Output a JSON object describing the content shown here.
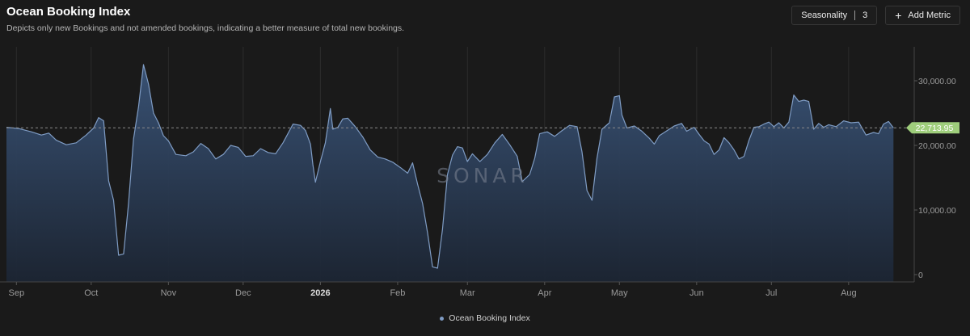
{
  "header": {
    "title": "Ocean Booking Index",
    "subtitle": "Depicts only new Bookings and not amended bookings, indicating a better measure of total new bookings."
  },
  "controls": {
    "seasonality_label": "Seasonality",
    "seasonality_value": "3",
    "add_metric_label": "Add Metric"
  },
  "watermark": "SONAR",
  "colors": {
    "background": "#1a1a1a",
    "line": "#7f9cc4",
    "fill_top": "#3a5478",
    "fill_bottom": "#1c2533",
    "last_value_badge": "#9fce7c",
    "grid": "#2c2c2c"
  },
  "chart_data": {
    "type": "area",
    "title": "Ocean Booking Index",
    "xlabel": "",
    "ylabel": "",
    "ylim": [
      0,
      35000
    ],
    "y_ticks": [
      {
        "value": 0,
        "label": "0"
      },
      {
        "value": 10000,
        "label": "10,000.00"
      },
      {
        "value": 20000,
        "label": "20,000.00"
      },
      {
        "value": 30000,
        "label": "30,000.00"
      }
    ],
    "x_ticks": [
      {
        "day": 4,
        "label": "Sep",
        "bold": false
      },
      {
        "day": 34,
        "label": "Oct",
        "bold": false
      },
      {
        "day": 65,
        "label": "Nov",
        "bold": false
      },
      {
        "day": 95,
        "label": "Dec",
        "bold": false
      },
      {
        "day": 126,
        "label": "2026",
        "bold": true
      },
      {
        "day": 157,
        "label": "Feb",
        "bold": false
      },
      {
        "day": 185,
        "label": "Mar",
        "bold": false
      },
      {
        "day": 216,
        "label": "Apr",
        "bold": false
      },
      {
        "day": 246,
        "label": "May",
        "bold": false
      },
      {
        "day": 277,
        "label": "Jun",
        "bold": false
      },
      {
        "day": 307,
        "label": "Jul",
        "bold": false
      },
      {
        "day": 338,
        "label": "Aug",
        "bold": false
      }
    ],
    "x_range": [
      0,
      364
    ],
    "grid": true,
    "legend_position": "bottom-center",
    "last_value": 22713.95,
    "last_value_label": "22,713.95",
    "series": [
      {
        "name": "Ocean Booking Index",
        "points": [
          [
            0,
            22800
          ],
          [
            5,
            22600
          ],
          [
            10,
            22100
          ],
          [
            14,
            21600
          ],
          [
            17,
            21900
          ],
          [
            20,
            20800
          ],
          [
            24,
            20100
          ],
          [
            28,
            20400
          ],
          [
            32,
            21600
          ],
          [
            35,
            22700
          ],
          [
            37,
            24300
          ],
          [
            39,
            23800
          ],
          [
            41,
            14500
          ],
          [
            43,
            11500
          ],
          [
            45,
            3000
          ],
          [
            47,
            3200
          ],
          [
            49,
            11000
          ],
          [
            51,
            21000
          ],
          [
            53,
            26000
          ],
          [
            55,
            32500
          ],
          [
            57,
            29500
          ],
          [
            59,
            25000
          ],
          [
            61,
            23500
          ],
          [
            63,
            21500
          ],
          [
            65,
            20700
          ],
          [
            68,
            18600
          ],
          [
            72,
            18400
          ],
          [
            75,
            19000
          ],
          [
            78,
            20300
          ],
          [
            81,
            19500
          ],
          [
            84,
            17900
          ],
          [
            87,
            18600
          ],
          [
            90,
            20000
          ],
          [
            93,
            19700
          ],
          [
            96,
            18300
          ],
          [
            99,
            18400
          ],
          [
            102,
            19500
          ],
          [
            105,
            18900
          ],
          [
            108,
            18700
          ],
          [
            111,
            20400
          ],
          [
            115,
            23300
          ],
          [
            118,
            23100
          ],
          [
            120,
            22300
          ],
          [
            122,
            20200
          ],
          [
            123,
            17000
          ],
          [
            124,
            14300
          ],
          [
            126,
            17500
          ],
          [
            128,
            20400
          ],
          [
            130,
            25700
          ],
          [
            131,
            22500
          ],
          [
            133,
            22800
          ],
          [
            135,
            24100
          ],
          [
            137,
            24200
          ],
          [
            140,
            22900
          ],
          [
            143,
            21300
          ],
          [
            146,
            19300
          ],
          [
            149,
            18200
          ],
          [
            152,
            17900
          ],
          [
            155,
            17400
          ],
          [
            158,
            16600
          ],
          [
            161,
            15700
          ],
          [
            163,
            17300
          ],
          [
            165,
            14000
          ],
          [
            167,
            11000
          ],
          [
            169,
            6500
          ],
          [
            171,
            1200
          ],
          [
            173,
            1000
          ],
          [
            175,
            7000
          ],
          [
            177,
            15500
          ],
          [
            179,
            18500
          ],
          [
            181,
            19800
          ],
          [
            183,
            19600
          ],
          [
            185,
            17500
          ],
          [
            187,
            18700
          ],
          [
            190,
            17500
          ],
          [
            193,
            18600
          ],
          [
            196,
            20400
          ],
          [
            199,
            21700
          ],
          [
            202,
            20100
          ],
          [
            205,
            18300
          ],
          [
            207,
            14400
          ],
          [
            210,
            15500
          ],
          [
            212,
            18000
          ],
          [
            214,
            21800
          ],
          [
            217,
            22100
          ],
          [
            220,
            21400
          ],
          [
            223,
            22300
          ],
          [
            226,
            23100
          ],
          [
            229,
            22900
          ],
          [
            231,
            19000
          ],
          [
            233,
            13000
          ],
          [
            235,
            11500
          ],
          [
            237,
            18000
          ],
          [
            239,
            22500
          ],
          [
            242,
            23500
          ],
          [
            244,
            27500
          ],
          [
            246,
            27700
          ],
          [
            247,
            24700
          ],
          [
            249,
            22700
          ],
          [
            252,
            23000
          ],
          [
            255,
            22200
          ],
          [
            258,
            21100
          ],
          [
            260,
            20200
          ],
          [
            262,
            21500
          ],
          [
            266,
            22500
          ],
          [
            268,
            23000
          ],
          [
            271,
            23400
          ],
          [
            273,
            22200
          ],
          [
            276,
            22800
          ],
          [
            278,
            21700
          ],
          [
            280,
            20700
          ],
          [
            282,
            20200
          ],
          [
            284,
            18600
          ],
          [
            286,
            19300
          ],
          [
            288,
            21200
          ],
          [
            290,
            20400
          ],
          [
            292,
            19300
          ],
          [
            294,
            17900
          ],
          [
            296,
            18300
          ],
          [
            298,
            20800
          ],
          [
            300,
            22800
          ],
          [
            302,
            22900
          ],
          [
            304,
            23300
          ],
          [
            306,
            23600
          ],
          [
            308,
            22900
          ],
          [
            310,
            23500
          ],
          [
            312,
            22700
          ],
          [
            314,
            23600
          ],
          [
            316,
            27800
          ],
          [
            318,
            26800
          ],
          [
            320,
            27000
          ],
          [
            322,
            26800
          ],
          [
            324,
            22500
          ],
          [
            326,
            23400
          ],
          [
            328,
            22800
          ],
          [
            330,
            23200
          ],
          [
            333,
            22900
          ],
          [
            336,
            23800
          ],
          [
            339,
            23500
          ],
          [
            342,
            23600
          ],
          [
            345,
            21600
          ],
          [
            348,
            22000
          ],
          [
            350,
            21800
          ],
          [
            352,
            23300
          ],
          [
            354,
            23700
          ],
          [
            356,
            22700
          ]
        ]
      }
    ]
  }
}
